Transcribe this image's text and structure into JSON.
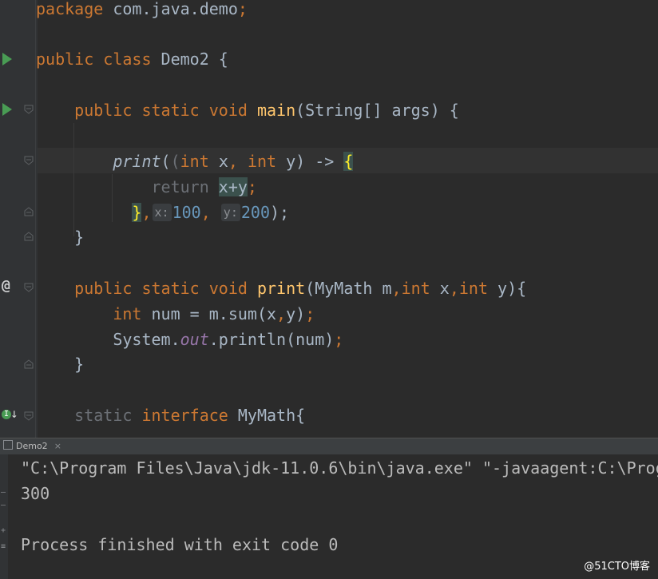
{
  "editor": {
    "lines": [
      {
        "id": "l0",
        "tokens": [
          {
            "t": "package ",
            "c": "kw"
          },
          {
            "t": "com.java.demo"
          },
          {
            "t": ";",
            "c": "semi"
          }
        ]
      },
      {
        "id": "l1",
        "tokens": [
          {
            "t": "public class ",
            "c": "kw"
          },
          {
            "t": "Demo2 {"
          }
        ]
      },
      {
        "id": "l2",
        "tokens": [
          {
            "t": "    public static void ",
            "c": "kw"
          },
          {
            "t": "main",
            "c": "fn"
          },
          {
            "t": "(String[] args) {"
          }
        ]
      },
      {
        "id": "l3",
        "tokens": [
          {
            "t": "        "
          },
          {
            "t": "print",
            "c": "it"
          },
          {
            "t": "("
          },
          {
            "t": "(",
            "c": "dim"
          },
          {
            "t": "int ",
            "c": "kw"
          },
          {
            "t": "x"
          },
          {
            "t": ", ",
            "c": "semi"
          },
          {
            "t": "int ",
            "c": "kw"
          },
          {
            "t": "y) -> "
          },
          {
            "t": "{",
            "c": "brace-hl"
          }
        ]
      },
      {
        "id": "l4",
        "tokens": [
          {
            "t": "            return ",
            "c": "dim"
          },
          {
            "t": "x+y",
            "c": "brace-hl-soft"
          },
          {
            "t": ";",
            "c": "semi"
          }
        ]
      },
      {
        "id": "l5",
        "tokens": [
          {
            "t": "          "
          },
          {
            "t": "}",
            "c": "brace-hl"
          },
          {
            "t": ",",
            "c": "semi"
          },
          {
            "t": "x:",
            "c": "hint"
          },
          {
            "t": "100",
            "c": "num"
          },
          {
            "t": ", ",
            "c": "semi"
          },
          {
            "t": "y:",
            "c": "hint"
          },
          {
            "t": "200",
            "c": "num"
          },
          {
            "t": ");"
          }
        ]
      },
      {
        "id": "l6",
        "tokens": [
          {
            "t": "    }"
          }
        ]
      },
      {
        "id": "l7",
        "tokens": [
          {
            "t": "    public static void ",
            "c": "kw"
          },
          {
            "t": "print",
            "c": "fn"
          },
          {
            "t": "(MyMath m"
          },
          {
            "t": ",",
            "c": "semi"
          },
          {
            "t": "int ",
            "c": "kw"
          },
          {
            "t": "x"
          },
          {
            "t": ",",
            "c": "semi"
          },
          {
            "t": "int ",
            "c": "kw"
          },
          {
            "t": "y){"
          }
        ]
      },
      {
        "id": "l8",
        "tokens": [
          {
            "t": "        int ",
            "c": "kw"
          },
          {
            "t": "num = m.sum(x"
          },
          {
            "t": ",",
            "c": "semi"
          },
          {
            "t": "y)"
          },
          {
            "t": ";",
            "c": "semi"
          }
        ]
      },
      {
        "id": "l9",
        "tokens": [
          {
            "t": "        System."
          },
          {
            "t": "out",
            "c": "field"
          },
          {
            "t": ".println(num)"
          },
          {
            "t": ";",
            "c": "semi"
          }
        ]
      },
      {
        "id": "l10",
        "tokens": [
          {
            "t": "    }"
          }
        ]
      },
      {
        "id": "l11",
        "tokens": [
          {
            "t": "    static ",
            "c": "dim"
          },
          {
            "t": "interface ",
            "c": "kw"
          },
          {
            "t": "MyMath{"
          }
        ]
      }
    ]
  },
  "console": {
    "tab_label": "Demo2",
    "tab_close": "×",
    "output": [
      "\"C:\\Program Files\\Java\\jdk-11.0.6\\bin\\java.exe\" \"-javaagent:C:\\Progr",
      "300",
      "",
      "Process finished with exit code 0"
    ]
  },
  "gutter_icons": {
    "at": "@",
    "implements": "I"
  },
  "watermark": "@51CTO博客"
}
